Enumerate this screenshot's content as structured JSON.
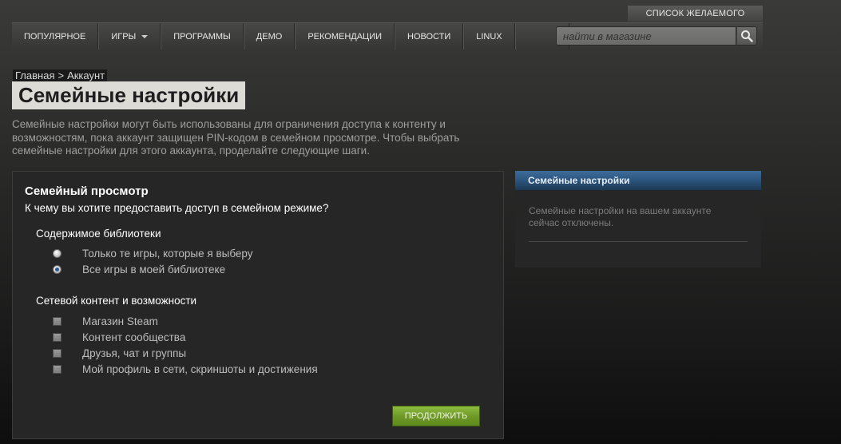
{
  "header": {
    "wishlist_label": "СПИСОК ЖЕЛАЕМОГО",
    "nav": [
      {
        "label": "ПОПУЛЯРНОЕ"
      },
      {
        "label": "ИГРЫ"
      },
      {
        "label": "ПРОГРАММЫ"
      },
      {
        "label": "ДЕМО"
      },
      {
        "label": "РЕКОМЕНДАЦИИ"
      },
      {
        "label": "НОВОСТИ"
      },
      {
        "label": "LINUX"
      }
    ],
    "search_placeholder": "найти в магазине"
  },
  "breadcrumb": {
    "home": "Главная",
    "separator": ">",
    "current": "Аккаунт"
  },
  "page_title": "Семейные настройки",
  "intro": "Семейные настройки могут быть использованы для ограничения доступа к контенту и возможностям, пока аккаунт защищен PIN-кодом в семейном просмотре. Чтобы выбрать семейные настройки для этого аккаунта, проделайте следующие шаги.",
  "family_view": {
    "title": "Семейный просмотр",
    "question": "К чему вы хотите предоставить доступ в семейном режиме?",
    "library": {
      "title": "Содержимое библиотеки",
      "options": [
        {
          "label": "Только те игры, которые я выберу",
          "selected": false
        },
        {
          "label": "Все игры в моей библиотеке",
          "selected": true
        }
      ]
    },
    "online": {
      "title": "Сетевой контент и возможности",
      "options": [
        {
          "label": "Магазин Steam",
          "checked": false
        },
        {
          "label": "Контент сообщества",
          "checked": false
        },
        {
          "label": "Друзья, чат и группы",
          "checked": false
        },
        {
          "label": "Мой профиль в сети, скриншоты и достижения",
          "checked": false
        }
      ]
    },
    "continue_label": "ПРОДОЛЖИТЬ"
  },
  "sidebar": {
    "title": "Семейные настройки",
    "status_text": "Семейные настройки на вашем аккаунте сейчас отключены."
  },
  "colors": {
    "accent_blue": "#2d5781",
    "continue_green": "#6f9a28"
  }
}
